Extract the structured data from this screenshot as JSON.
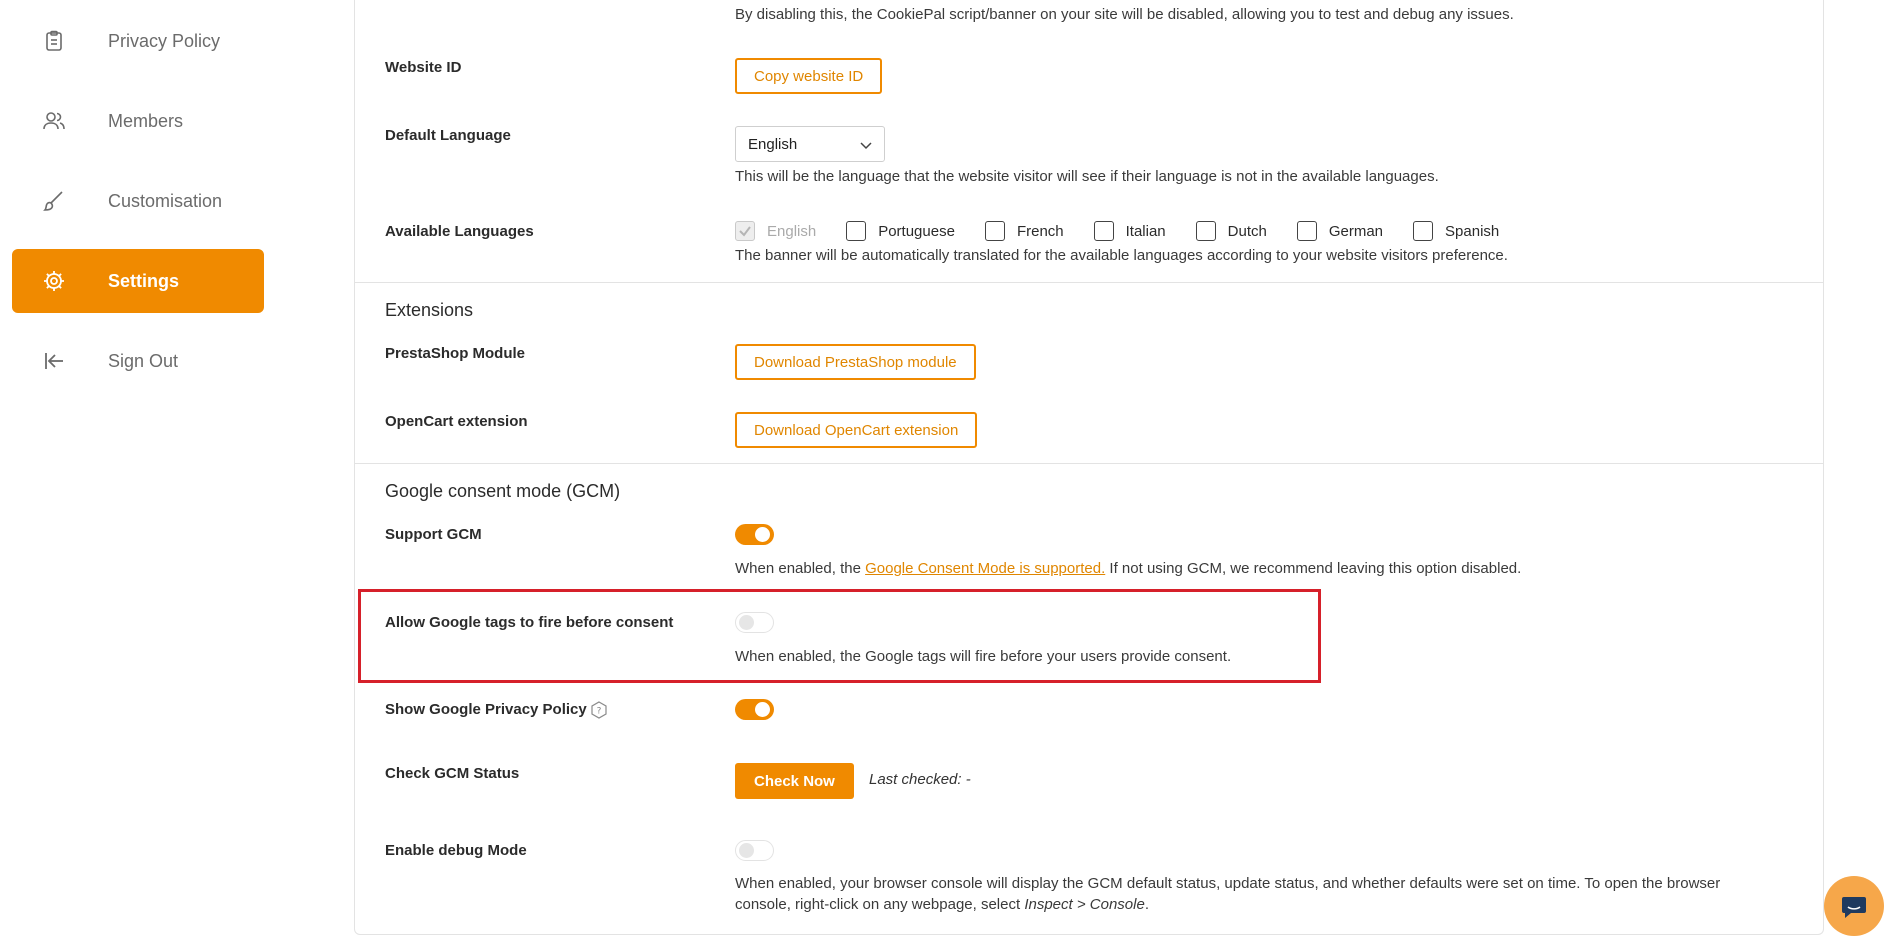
{
  "sidebar": {
    "items": [
      {
        "label": "Privacy Policy",
        "icon": "clipboard-icon"
      },
      {
        "label": "Members",
        "icon": "users-icon"
      },
      {
        "label": "Customisation",
        "icon": "brush-icon"
      },
      {
        "label": "Settings",
        "icon": "gear-icon",
        "active": true
      },
      {
        "label": "Sign Out",
        "icon": "sign-out-icon"
      }
    ]
  },
  "general": {
    "disable_desc": "By disabling this, the CookiePal script/banner on your site will be disabled, allowing you to test and debug any issues.",
    "website_id_label": "Website ID",
    "copy_website_id": "Copy website ID",
    "default_language_label": "Default Language",
    "default_language_value": "English",
    "default_language_desc": "This will be the language that the website visitor will see if their language is not in the available languages.",
    "available_languages_label": "Available Languages",
    "languages": [
      "English",
      "Portuguese",
      "French",
      "Italian",
      "Dutch",
      "German",
      "Spanish"
    ],
    "available_languages_desc": "The banner will be automatically translated for the available languages according to your website visitors preference."
  },
  "extensions": {
    "title": "Extensions",
    "prestashop_label": "PrestaShop Module",
    "prestashop_button": "Download PrestaShop module",
    "opencart_label": "OpenCart extension",
    "opencart_button": "Download OpenCart extension"
  },
  "gcm": {
    "title": "Google consent mode (GCM)",
    "support_label": "Support GCM",
    "support_on": true,
    "support_desc_before": "When enabled, the ",
    "support_desc_link": "Google Consent Mode is supported.",
    "support_desc_after": " If not using GCM, we recommend leaving this option disabled.",
    "allow_tags_label": "Allow Google tags to fire before consent",
    "allow_tags_on": false,
    "allow_tags_desc": "When enabled, the Google tags will fire before your users provide consent.",
    "show_privacy_label": "Show Google Privacy Policy",
    "show_privacy_on": true,
    "check_status_label": "Check GCM Status",
    "check_now_button": "Check Now",
    "last_checked": "Last checked: -",
    "debug_label": "Enable debug Mode",
    "debug_on": false,
    "debug_desc_line1": "When enabled, your browser console will display the GCM default status, update status, and whether defaults were set on time. To open the browser",
    "debug_desc_line2_before": "console, right-click on any webpage, select ",
    "debug_desc_line2_em": "Inspect > Console",
    "debug_desc_line2_after": "."
  },
  "colors": {
    "accent": "#f08a00",
    "highlight": "#d6202a"
  }
}
